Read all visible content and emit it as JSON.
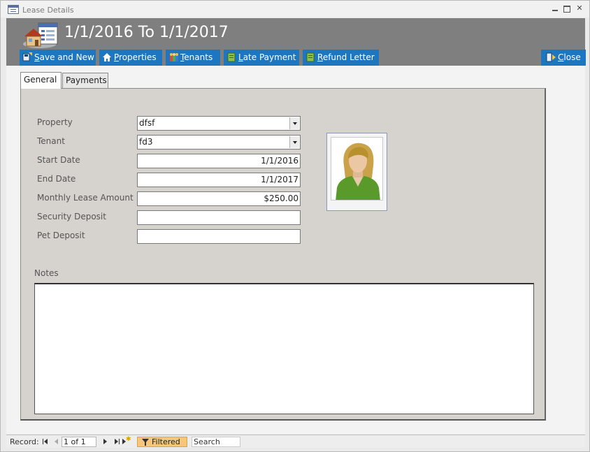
{
  "window": {
    "title": "Lease Details"
  },
  "header": {
    "heading": "1/1/2016 To 1/1/2017"
  },
  "toolbar": {
    "save_new": {
      "underline": "S",
      "rest": "ave and New"
    },
    "properties": {
      "underline": "P",
      "rest": "roperties"
    },
    "tenants": {
      "underline": "T",
      "rest": "enants"
    },
    "late_payment": {
      "underline": "L",
      "rest": "ate Payment"
    },
    "refund_letter": {
      "underline": "R",
      "rest": "efund Letter"
    },
    "close": {
      "underline": "C",
      "rest": "lose"
    }
  },
  "tabs": [
    {
      "label": "General",
      "active": true
    },
    {
      "label": "Payments",
      "active": false
    }
  ],
  "form": {
    "property": {
      "label": "Property",
      "value": "dfsf"
    },
    "tenant": {
      "label": "Tenant",
      "value": "fd3"
    },
    "start_date": {
      "label": "Start Date",
      "value": "1/1/2016"
    },
    "end_date": {
      "label": "End Date",
      "value": "1/1/2017"
    },
    "monthly_lease": {
      "label": "Monthly Lease Amount",
      "value": "$250.00"
    },
    "security_deposit": {
      "label": "Security Deposit",
      "value": ""
    },
    "pet_deposit": {
      "label": "Pet Deposit",
      "value": ""
    },
    "notes": {
      "label": "Notes",
      "value": ""
    }
  },
  "navigation": {
    "record_label": "Record:",
    "record_position": "1 of 1",
    "filter_label": "Filtered",
    "search_label": "Search"
  },
  "colors": {
    "header_bg": "#7f7f7f",
    "button_bg": "#1d77c0",
    "tab_page_bg": "#d6d3ce",
    "filter_highlight": "#f6c77a"
  }
}
